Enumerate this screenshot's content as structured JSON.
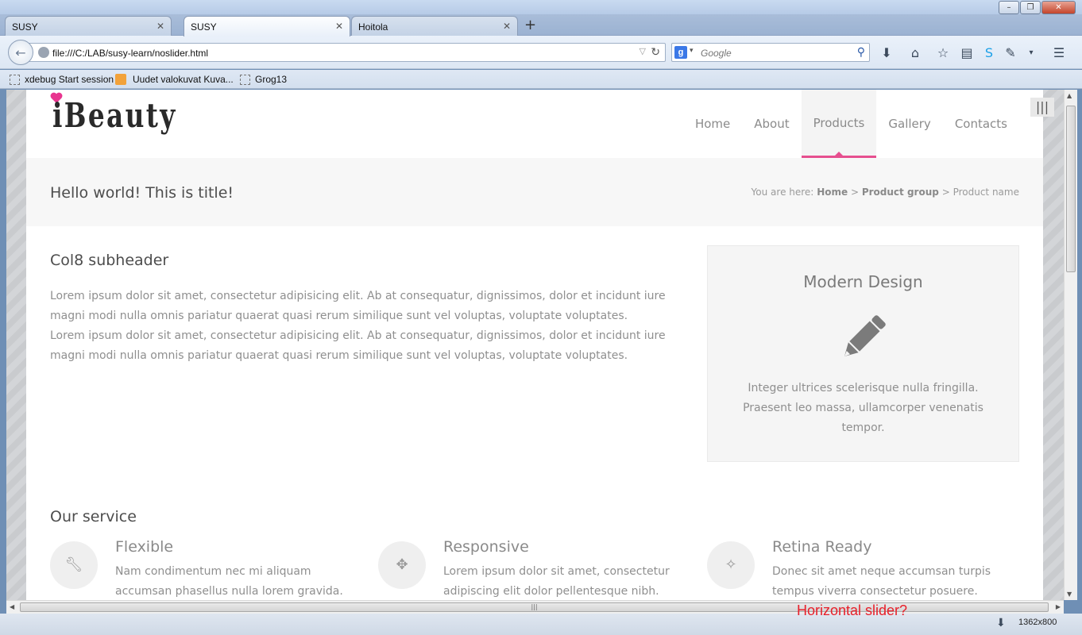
{
  "browser": {
    "tabs": [
      {
        "label": "SUSY"
      },
      {
        "label": "SUSY"
      },
      {
        "label": "Hoitola"
      }
    ],
    "new_tab_symbol": "+",
    "tab_close_symbol": "✕",
    "url": "file:///C:/LAB/susy-learn/noslider.html",
    "search_placeholder": "Google",
    "bookmarks": [
      {
        "label": "xdebug Start session"
      },
      {
        "label": "Uudet valokuvat Kuva..."
      },
      {
        "label": "Grog13"
      }
    ],
    "resolution": "1362x800",
    "annotation": "Horizontal slider?"
  },
  "site": {
    "logo_text": "iBeauty",
    "nav": [
      {
        "label": "Home"
      },
      {
        "label": "About"
      },
      {
        "label": "Products"
      },
      {
        "label": "Gallery"
      },
      {
        "label": "Contacts"
      }
    ],
    "active_nav": "Products",
    "accent_color": "#e64f8f",
    "page_title": "Hello world! This is title!",
    "breadcrumb": {
      "prefix": "You are here:",
      "home": "Home",
      "group": "Product group",
      "current": "Product name",
      "separator": ">"
    },
    "subheader": "Col8 subheader",
    "paragraph_1": "Lorem ipsum dolor sit amet, consectetur adipisicing elit. Ab at consequatur, dignissimos, dolor et incidunt iure magni modi nulla omnis pariatur quaerat quasi rerum similique sunt vel voluptas, voluptate voluptates.",
    "paragraph_2": "Lorem ipsum dolor sit amet, consectetur adipisicing elit. Ab at consequatur, dignissimos, dolor et incidunt iure magni modi nulla omnis pariatur quaerat quasi rerum similique sunt vel voluptas, voluptate voluptates.",
    "feature": {
      "title": "Modern Design",
      "icon": "pencil-icon",
      "text": "Integer ultrices scelerisque nulla fringilla. Praesent leo massa, ullamcorper venenatis tempor."
    },
    "service_title": "Our service",
    "services": [
      {
        "icon": "wrench-icon",
        "title": "Flexible",
        "text": "Nam condimentum nec mi aliquam accumsan phasellus nulla lorem gravida."
      },
      {
        "icon": "move-icon",
        "title": "Responsive",
        "text": "Lorem ipsum dolor sit amet, consectetur adipiscing elit dolor pellentesque nibh."
      },
      {
        "icon": "magic-wand-icon",
        "title": "Retina Ready",
        "text": "Donec sit amet neque accumsan turpis tempus viverra consectetur posuere."
      }
    ]
  }
}
